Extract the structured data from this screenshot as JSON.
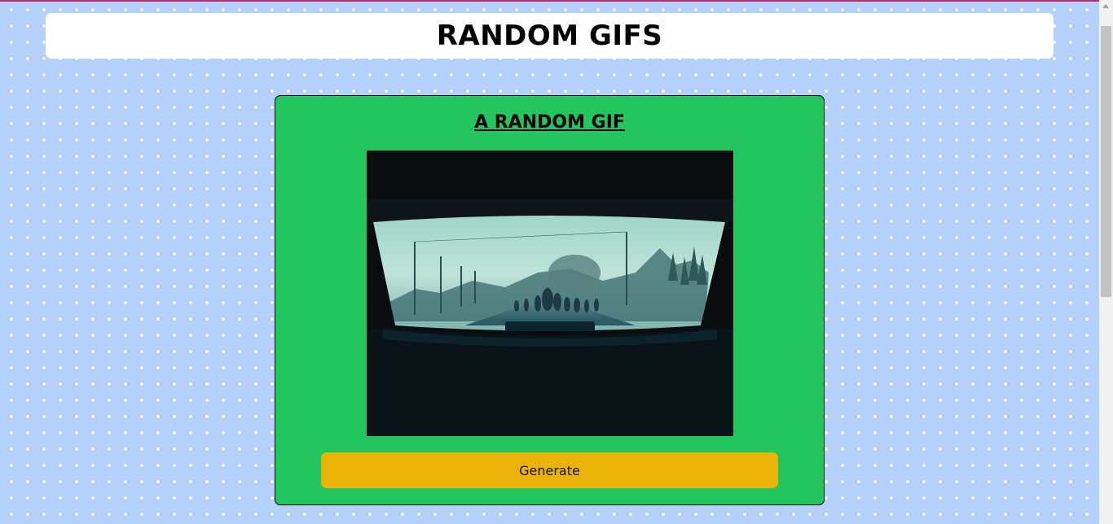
{
  "header": {
    "title": "RANDOM GIFS"
  },
  "card": {
    "title": "A RANDOM GIF",
    "gif_alt": "random gif",
    "generate_label": "Generate"
  },
  "colors": {
    "page_background": "#b3d1fb",
    "card_background": "#22c55e",
    "button_background": "#eab308",
    "header_background": "#ffffff"
  },
  "icons": {
    "scroll_up": "chevron-up-icon"
  }
}
